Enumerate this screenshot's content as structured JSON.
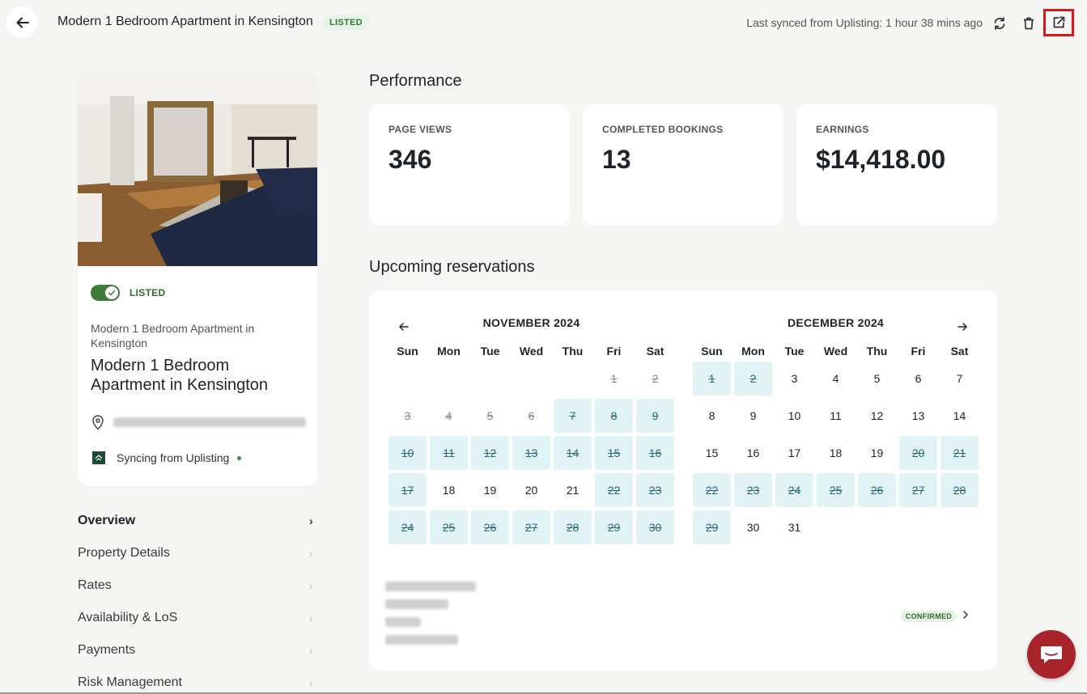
{
  "header": {
    "title": "Modern 1 Bedroom Apartment in Kensington",
    "status_badge": "LISTED",
    "sync_text": "Last synced from Uplisting: 1 hour 38 mins ago"
  },
  "listing_card": {
    "toggle_label": "LISTED",
    "toggle_on": true,
    "subtitle": "Modern 1 Bedroom Apartment in Kensington",
    "name": "Modern 1 Bedroom Apartment in Kensington",
    "syncing_text": "Syncing from Uplisting"
  },
  "nav": [
    {
      "label": "Overview",
      "active": true
    },
    {
      "label": "Property Details",
      "active": false
    },
    {
      "label": "Rates",
      "active": false
    },
    {
      "label": "Availability & LoS",
      "active": false
    },
    {
      "label": "Payments",
      "active": false
    },
    {
      "label": "Risk Management",
      "active": false
    }
  ],
  "performance": {
    "title": "Performance",
    "stats": [
      {
        "label": "PAGE VIEWS",
        "value": "346"
      },
      {
        "label": "COMPLETED BOOKINGS",
        "value": "13"
      },
      {
        "label": "EARNINGS",
        "value": "$14,418.00"
      }
    ]
  },
  "reservations": {
    "title": "Upcoming reservations",
    "weekdays": [
      "Sun",
      "Mon",
      "Tue",
      "Wed",
      "Thu",
      "Fri",
      "Sat"
    ],
    "months": [
      {
        "title": "NOVEMBER 2024",
        "offset": 5,
        "days": 30,
        "past": [
          1,
          2,
          3,
          4,
          5,
          6
        ],
        "booked": [
          7,
          8,
          9,
          10,
          11,
          12,
          13,
          14,
          15,
          16,
          17,
          22,
          23,
          24,
          25,
          26,
          27,
          28,
          29,
          30
        ]
      },
      {
        "title": "DECEMBER 2024",
        "offset": 0,
        "days": 31,
        "past": [],
        "booked": [
          1,
          2,
          20,
          21,
          22,
          23,
          24,
          25,
          26,
          27,
          28,
          29
        ]
      }
    ],
    "reservation_status": "CONFIRMED"
  },
  "colors": {
    "accent_green": "#3f7a3b",
    "booked_bg": "#e2f3f6",
    "chat_red": "#a8232a",
    "highlight_box": "#e1141c"
  },
  "icons": {
    "back": "arrow-left-icon",
    "sync": "refresh-icon",
    "delete": "trash-icon",
    "open_external": "external-link-icon",
    "location": "location-pin-icon",
    "chat": "chat-bubble-icon"
  }
}
